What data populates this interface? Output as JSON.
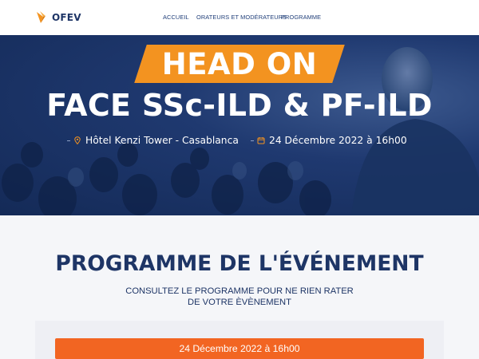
{
  "brand": {
    "logo_text": "OFEV",
    "accent": "#f39320",
    "navy": "#1e3566",
    "orange": "#f26522"
  },
  "nav": {
    "items": [
      {
        "label": "ACCUEIL"
      },
      {
        "label": "ORATEURS ET MODÉRATEURS"
      },
      {
        "label": "PROGRAMME"
      }
    ]
  },
  "hero": {
    "badge": "HEAD ON",
    "title": "FACE SSc-ILD & PF-ILD",
    "location": "Hôtel Kenzi Tower - Casablanca",
    "location_icon": "location-pin-icon",
    "date": "24 Décembre 2022 à 16h00",
    "date_icon": "calendar-icon"
  },
  "program": {
    "title": "PROGRAMME DE L'ÉVÉNEMENT",
    "subtitle": "CONSULTEZ LE PROGRAMME POUR NE RIEN RATER DE VOTRE ÈVÈNEMENT",
    "date_bar": "24 Décembre 2022 à 16h00"
  }
}
